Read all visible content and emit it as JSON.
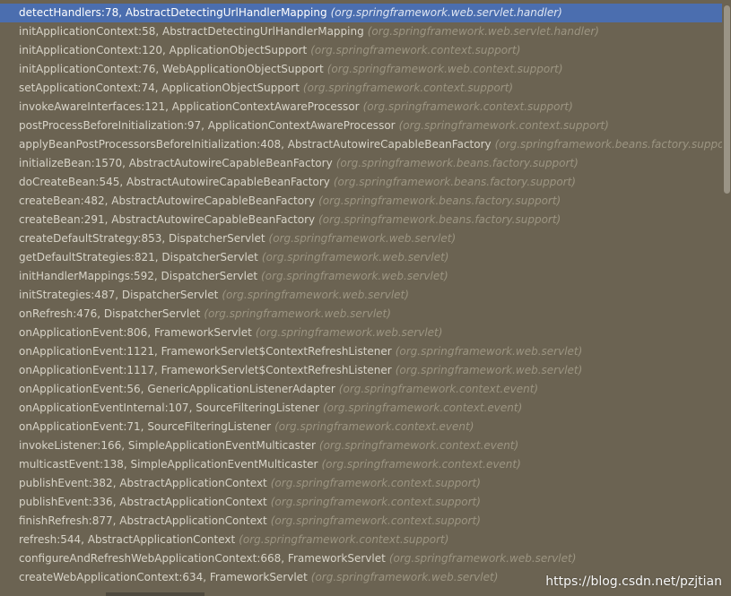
{
  "frames": [
    {
      "method": "detectHandlers:78, AbstractDetectingUrlHandlerMapping",
      "package": "(org.springframework.web.servlet.handler)",
      "selected": true
    },
    {
      "method": "initApplicationContext:58, AbstractDetectingUrlHandlerMapping",
      "package": "(org.springframework.web.servlet.handler)"
    },
    {
      "method": "initApplicationContext:120, ApplicationObjectSupport",
      "package": "(org.springframework.context.support)"
    },
    {
      "method": "initApplicationContext:76, WebApplicationObjectSupport",
      "package": "(org.springframework.web.context.support)"
    },
    {
      "method": "setApplicationContext:74, ApplicationObjectSupport",
      "package": "(org.springframework.context.support)"
    },
    {
      "method": "invokeAwareInterfaces:121, ApplicationContextAwareProcessor",
      "package": "(org.springframework.context.support)"
    },
    {
      "method": "postProcessBeforeInitialization:97, ApplicationContextAwareProcessor",
      "package": "(org.springframework.context.support)"
    },
    {
      "method": "applyBeanPostProcessorsBeforeInitialization:408, AbstractAutowireCapableBeanFactory",
      "package": "(org.springframework.beans.factory.support)"
    },
    {
      "method": "initializeBean:1570, AbstractAutowireCapableBeanFactory",
      "package": "(org.springframework.beans.factory.support)"
    },
    {
      "method": "doCreateBean:545, AbstractAutowireCapableBeanFactory",
      "package": "(org.springframework.beans.factory.support)"
    },
    {
      "method": "createBean:482, AbstractAutowireCapableBeanFactory",
      "package": "(org.springframework.beans.factory.support)"
    },
    {
      "method": "createBean:291, AbstractAutowireCapableBeanFactory",
      "package": "(org.springframework.beans.factory.support)"
    },
    {
      "method": "createDefaultStrategy:853, DispatcherServlet",
      "package": "(org.springframework.web.servlet)"
    },
    {
      "method": "getDefaultStrategies:821, DispatcherServlet",
      "package": "(org.springframework.web.servlet)"
    },
    {
      "method": "initHandlerMappings:592, DispatcherServlet",
      "package": "(org.springframework.web.servlet)"
    },
    {
      "method": "initStrategies:487, DispatcherServlet",
      "package": "(org.springframework.web.servlet)"
    },
    {
      "method": "onRefresh:476, DispatcherServlet",
      "package": "(org.springframework.web.servlet)"
    },
    {
      "method": "onApplicationEvent:806, FrameworkServlet",
      "package": "(org.springframework.web.servlet)"
    },
    {
      "method": "onApplicationEvent:1121, FrameworkServlet$ContextRefreshListener",
      "package": "(org.springframework.web.servlet)"
    },
    {
      "method": "onApplicationEvent:1117, FrameworkServlet$ContextRefreshListener",
      "package": "(org.springframework.web.servlet)"
    },
    {
      "method": "onApplicationEvent:56, GenericApplicationListenerAdapter",
      "package": "(org.springframework.context.event)"
    },
    {
      "method": "onApplicationEventInternal:107, SourceFilteringListener",
      "package": "(org.springframework.context.event)"
    },
    {
      "method": "onApplicationEvent:71, SourceFilteringListener",
      "package": "(org.springframework.context.event)"
    },
    {
      "method": "invokeListener:166, SimpleApplicationEventMulticaster",
      "package": "(org.springframework.context.event)"
    },
    {
      "method": "multicastEvent:138, SimpleApplicationEventMulticaster",
      "package": "(org.springframework.context.event)"
    },
    {
      "method": "publishEvent:382, AbstractApplicationContext",
      "package": "(org.springframework.context.support)"
    },
    {
      "method": "publishEvent:336, AbstractApplicationContext",
      "package": "(org.springframework.context.support)"
    },
    {
      "method": "finishRefresh:877, AbstractApplicationContext",
      "package": "(org.springframework.context.support)"
    },
    {
      "method": "refresh:544, AbstractApplicationContext",
      "package": "(org.springframework.context.support)"
    },
    {
      "method": "configureAndRefreshWebApplicationContext:668, FrameworkServlet",
      "package": "(org.springframework.web.servlet)"
    },
    {
      "method": "createWebApplicationContext:634, FrameworkServlet",
      "package": "(org.springframework.web.servlet)"
    }
  ],
  "watermark": "https://blog.csdn.net/pzjtian",
  "colors": {
    "background": "#6b6352",
    "selection": "#4b6eaf",
    "method_text": "#d8d4c8",
    "package_text": "#9c9582"
  }
}
